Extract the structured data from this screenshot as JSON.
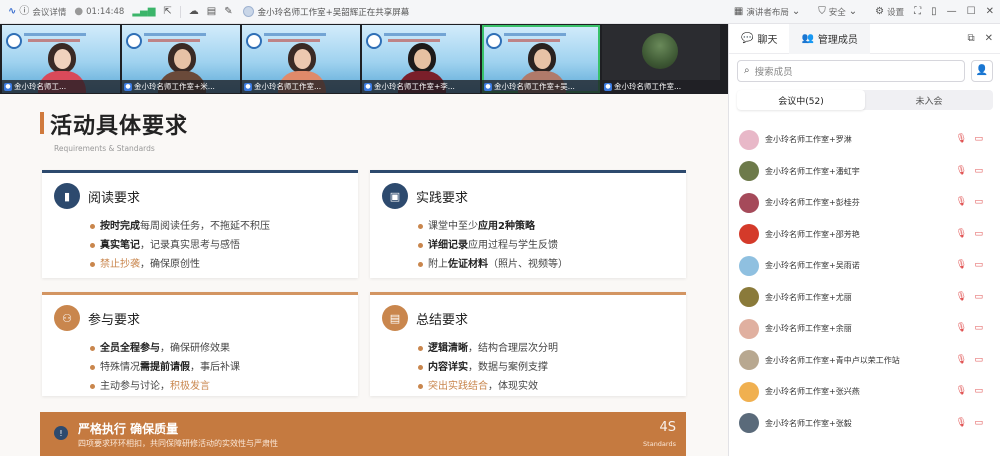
{
  "topbar": {
    "meeting_info": "会议详情",
    "timer": "01:14:48",
    "share_banner": "金小玲名师工作室+吴韶辉正在共享屏幕",
    "speaker_layout": "演讲者布局",
    "security": "安全",
    "settings": "设置"
  },
  "video_tiles": [
    {
      "name": "金小玲名师工..."
    },
    {
      "name": "金小玲名师工作室+米..."
    },
    {
      "name": "金小玲名师工作室..."
    },
    {
      "name": "金小玲名师工作室+李..."
    },
    {
      "name": "金小玲名师工作室+吴..."
    },
    {
      "name": "金小玲名师工作室..."
    }
  ],
  "slide": {
    "title": "活动具体要求",
    "subtitle": "Requirements & Standards",
    "cards": [
      {
        "title": "阅读要求",
        "items": [
          {
            "bold": "按时完成",
            "rest": "每周阅读任务，不拖延不积压"
          },
          {
            "bold": "真实笔记",
            "rest": "，记录真实思考与感悟"
          },
          {
            "hl": "禁止抄袭",
            "rest": "，确保原创性"
          }
        ]
      },
      {
        "title": "实践要求",
        "items": [
          {
            "pre": "课堂中至少",
            "bold": "应用2种策略"
          },
          {
            "bold": "详细记录",
            "rest": "应用过程与学生反馈"
          },
          {
            "pre": "附上",
            "bold": "佐证材料",
            "rest": "（照片、视频等）"
          }
        ]
      },
      {
        "title": "参与要求",
        "items": [
          {
            "bold": "全员全程参与",
            "rest": "，确保研修效果"
          },
          {
            "pre": "特殊情况",
            "bold": "需提前请假",
            "rest": "，事后补课"
          },
          {
            "pre": "主动参与讨论，",
            "hl": "积极发言"
          }
        ]
      },
      {
        "title": "总结要求",
        "items": [
          {
            "bold": "逻辑清晰",
            "rest": "，结构合理层次分明"
          },
          {
            "bold": "内容详实",
            "rest": "，数据与案例支撑"
          },
          {
            "hl": "突出实践结合",
            "rest": "，体现实效"
          }
        ]
      }
    ],
    "footer": {
      "title": "严格执行 确保质量",
      "subtitle": "四项要求环环相扣，共同保障研修活动的实效性与严肃性",
      "badge": "4S",
      "badge_sub": "Standards"
    }
  },
  "panel": {
    "tab_chat": "聊天",
    "tab_members": "管理成员",
    "search_placeholder": "搜索成员",
    "seg_in_meeting": "会议中(52)",
    "seg_not_joined": "未入会",
    "members": [
      {
        "name": "金小玲名师工作室+罗淋",
        "color": "#e8b8c8"
      },
      {
        "name": "金小玲名师工作室+潘虹宇",
        "color": "#6d7a4a"
      },
      {
        "name": "金小玲名师工作室+彭桂芬",
        "color": "#a54a5a"
      },
      {
        "name": "金小玲名师工作室+邵芳艳",
        "color": "#d43a2a"
      },
      {
        "name": "金小玲名师工作室+吴雨诺",
        "color": "#8fc0e0"
      },
      {
        "name": "金小玲名师工作室+尤丽",
        "color": "#8a7a3a"
      },
      {
        "name": "金小玲名师工作室+余丽",
        "color": "#e0b0a0"
      },
      {
        "name": "金小玲名师工作室+青中卢以荣工作站",
        "color": "#b8a890"
      },
      {
        "name": "金小玲名师工作室+张兴燕",
        "color": "#f0b050"
      },
      {
        "name": "金小玲名师工作室+张毅",
        "color": "#5a6a7a"
      }
    ]
  }
}
